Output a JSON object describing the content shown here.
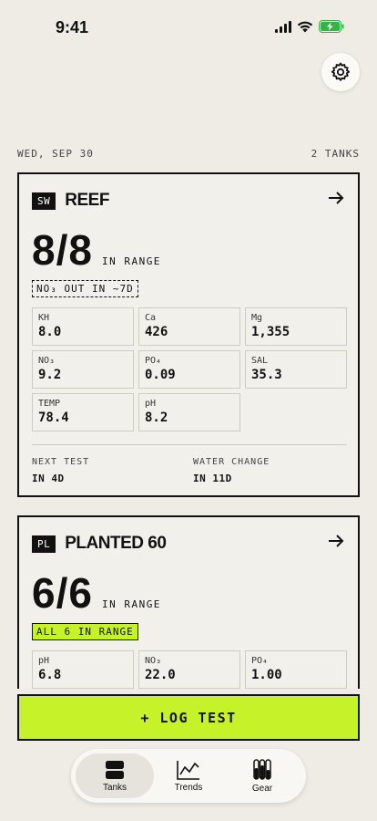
{
  "status": {
    "time": "9:41"
  },
  "date_row": {
    "date": "WED, SEP 30",
    "tank_count": "2 TANKS"
  },
  "tanks": [
    {
      "type": "SW",
      "name": "REEF",
      "score": "8/8",
      "score_label": "IN RANGE",
      "alert": "NO₃ OUT IN ~7D",
      "params": [
        {
          "name": "KH",
          "value": "8.0"
        },
        {
          "name": "Ca",
          "value": "426"
        },
        {
          "name": "Mg",
          "value": "1,355"
        },
        {
          "name": "NO₃",
          "value": "9.2"
        },
        {
          "name": "PO₄",
          "value": "0.09"
        },
        {
          "name": "SAL",
          "value": "35.3"
        },
        {
          "name": "TEMP",
          "value": "78.4"
        },
        {
          "name": "pH",
          "value": "8.2"
        }
      ],
      "next_test_label": "NEXT TEST",
      "next_test": "IN 4D",
      "water_change_label": "WATER CHANGE",
      "water_change": "IN 11D"
    },
    {
      "type": "PL",
      "name": "PLANTED 60",
      "score": "6/6",
      "score_label": "IN RANGE",
      "alert": "ALL 6 IN RANGE",
      "params": [
        {
          "name": "pH",
          "value": "6.8"
        },
        {
          "name": "NO₃",
          "value": "22.0"
        },
        {
          "name": "PO₄",
          "value": "1.00"
        }
      ]
    }
  ],
  "log_button": {
    "label": "+ LOG TEST"
  },
  "tabs": [
    {
      "label": "Tanks",
      "icon": "tanks-icon",
      "active": true
    },
    {
      "label": "Trends",
      "icon": "trends-icon",
      "active": false
    },
    {
      "label": "Gear",
      "icon": "gear-icon",
      "active": false
    }
  ],
  "colors": {
    "accent": "#c6f22a",
    "background": "#efece6",
    "ink": "#111111"
  }
}
